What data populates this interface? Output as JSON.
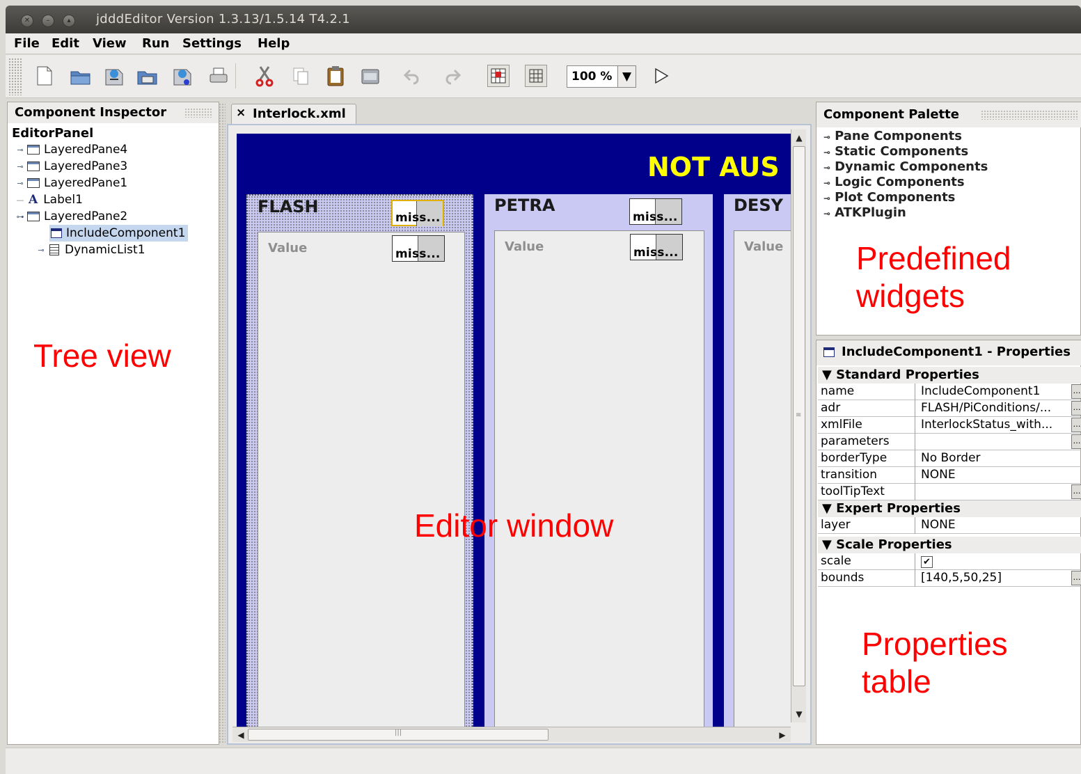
{
  "window": {
    "title": "jdddEditor Version 1.3.13/1.5.14 T4.2.1"
  },
  "menu": [
    "File",
    "Edit",
    "View",
    "Run",
    "Settings",
    "Help"
  ],
  "toolbar": {
    "zoom": "100 %"
  },
  "inspector": {
    "title": "Component Inspector",
    "root": "EditorPanel",
    "items": [
      {
        "label": "LayeredPane4"
      },
      {
        "label": "LayeredPane3"
      },
      {
        "label": "LayeredPane1"
      },
      {
        "label": "Label1"
      },
      {
        "label": "LayeredPane2"
      },
      {
        "label": "IncludeComponent1"
      },
      {
        "label": "DynamicList1"
      }
    ]
  },
  "editor": {
    "tab": "Interlock.xml",
    "banner": "NOT AUS",
    "columns": [
      {
        "title": "FLASH",
        "value_label": "Value"
      },
      {
        "title": "PETRA",
        "value_label": "Value"
      },
      {
        "title": "DESY",
        "value_label": "Value"
      }
    ],
    "missing_label": "miss..."
  },
  "palette": {
    "title": "Component Palette",
    "items": [
      "Pane Components",
      "Static Components",
      "Dynamic Components",
      "Logic Components",
      "Plot Components",
      "ATKPlugin"
    ]
  },
  "properties": {
    "title": "IncludeComponent1 - Properties",
    "sections": [
      {
        "name": "Standard Properties",
        "rows": [
          {
            "key": "name",
            "value": "IncludeComponent1"
          },
          {
            "key": "adr",
            "value": "FLASH/PiConditions/..."
          },
          {
            "key": "xmlFile",
            "value": "InterlockStatus_with..."
          },
          {
            "key": "parameters",
            "value": ""
          },
          {
            "key": "borderType",
            "value": "No Border"
          },
          {
            "key": "transition",
            "value": "NONE"
          },
          {
            "key": "toolTipText",
            "value": ""
          }
        ]
      },
      {
        "name": "Expert Properties",
        "rows": [
          {
            "key": "layer",
            "value": "NONE"
          }
        ]
      },
      {
        "name": "Scale Properties",
        "rows": [
          {
            "key": "scale",
            "value": "✔"
          },
          {
            "key": "bounds",
            "value": "[140,5,50,25]"
          }
        ]
      }
    ]
  },
  "annotations": {
    "tree": "Tree view",
    "editor": "Editor window",
    "palette": [
      "Predefined",
      "widgets"
    ],
    "properties": [
      "Properties",
      "table"
    ]
  },
  "colors": {
    "canvas": "#00008b",
    "banner_text": "#ffff00",
    "column_bg": "#c9c9f4",
    "annotation": "#ff0000",
    "selection": "#c5d7ef"
  }
}
